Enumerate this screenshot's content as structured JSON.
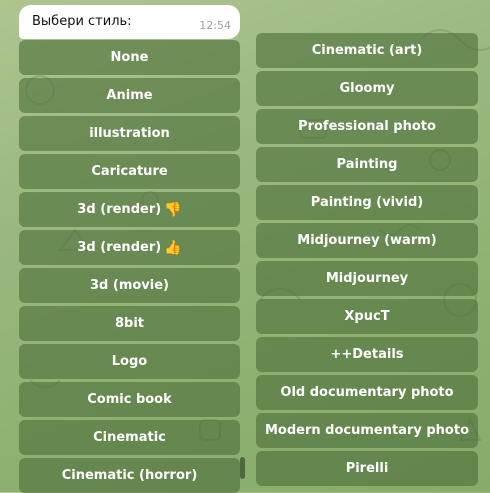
{
  "message": {
    "text": "Выбери стиль:",
    "time": "12:54"
  },
  "keyboard": {
    "left_column": [
      {
        "label": "None"
      },
      {
        "label": "Anime"
      },
      {
        "label": "illustration"
      },
      {
        "label": "Caricature"
      },
      {
        "label": "3d (render)",
        "emoji": "👎",
        "emoji_icon": "thumbs-down-icon"
      },
      {
        "label": "3d (render)",
        "emoji": "👍",
        "emoji_icon": "thumbs-up-icon"
      },
      {
        "label": "3d (movie)"
      },
      {
        "label": "8bit"
      },
      {
        "label": "Logo"
      },
      {
        "label": "Comic book"
      },
      {
        "label": "Cinematic"
      },
      {
        "label": "Cinematic (horror)"
      }
    ],
    "right_column": [
      {
        "label": "Cinematic (art)"
      },
      {
        "label": "Gloomy"
      },
      {
        "label": "Professional photo"
      },
      {
        "label": "Painting"
      },
      {
        "label": "Painting (vivid)"
      },
      {
        "label": "Midjourney (warm)"
      },
      {
        "label": "Midjourney"
      },
      {
        "label": "XpucT"
      },
      {
        "label": "++Details"
      },
      {
        "label": "Old documentary photo"
      },
      {
        "label": "Modern documentary photo"
      },
      {
        "label": "Pirelli"
      }
    ]
  },
  "colors": {
    "button_bg": "#5f8547",
    "background": "#9ab87e"
  }
}
